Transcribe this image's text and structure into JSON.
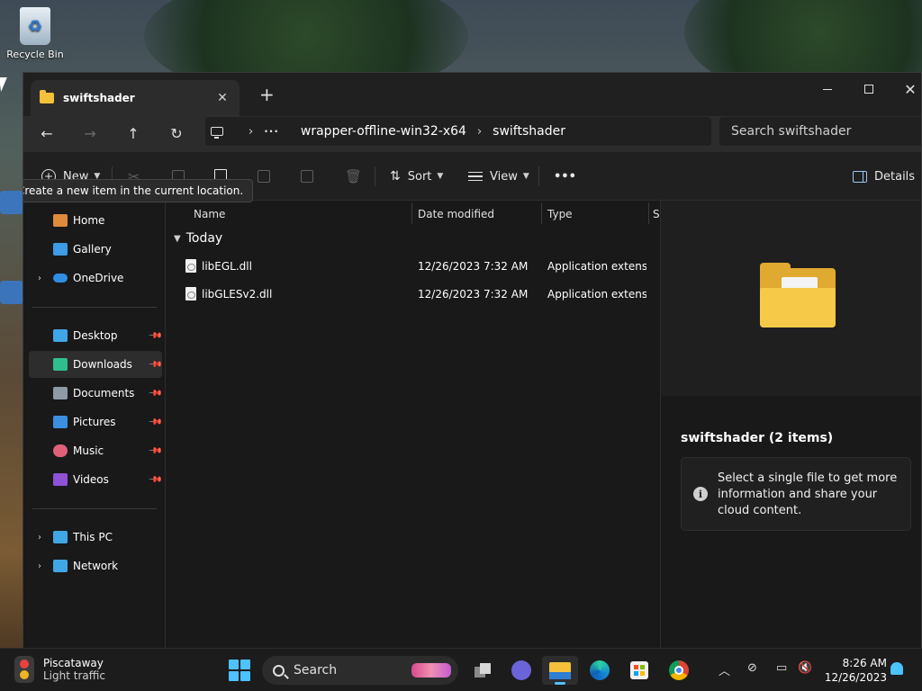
{
  "desktop": {
    "recycle_bin_label": "Recycle Bin"
  },
  "window": {
    "tab_title": "swiftshader",
    "new_tab": "+",
    "tooltip": "Create a new item in the current location.",
    "breadcrumbs": [
      "wrapper-offline-win32-x64",
      "swiftshader"
    ],
    "search_placeholder": "Search swiftshader"
  },
  "commands": {
    "new": "New",
    "sort": "Sort",
    "view": "View",
    "more": "•••",
    "details": "Details"
  },
  "sidebar": {
    "items": [
      {
        "label": "Home",
        "icon": "home-icon",
        "color": "#e08a3c"
      },
      {
        "label": "Gallery",
        "icon": "gallery-icon",
        "color": "#3d9be8"
      },
      {
        "label": "OneDrive",
        "icon": "onedrive-icon",
        "color": "#2f8fe3"
      },
      {
        "label": "Desktop",
        "icon": "desktop-icon",
        "color": "#3fa7e6"
      },
      {
        "label": "Downloads",
        "icon": "downloads-icon",
        "color": "#2fbf8f"
      },
      {
        "label": "Documents",
        "icon": "documents-icon",
        "color": "#8f9aa6"
      },
      {
        "label": "Pictures",
        "icon": "pictures-icon",
        "color": "#3c8fe0"
      },
      {
        "label": "Music",
        "icon": "music-icon",
        "color": "#e0607a"
      },
      {
        "label": "Videos",
        "icon": "videos-icon",
        "color": "#8e52d6"
      },
      {
        "label": "This PC",
        "icon": "this-pc-icon",
        "color": "#3fa7e6"
      },
      {
        "label": "Network",
        "icon": "network-icon",
        "color": "#3fa7e6"
      }
    ],
    "pin_glyph": "📌"
  },
  "filelist": {
    "columns": [
      "Name",
      "Date modified",
      "Type",
      "S"
    ],
    "group": "Today",
    "files": [
      {
        "name": "libEGL.dll",
        "date": "12/26/2023 7:32 AM",
        "type": "Application extens..."
      },
      {
        "name": "libGLESv2.dll",
        "date": "12/26/2023 7:32 AM",
        "type": "Application extens..."
      }
    ]
  },
  "details_pane": {
    "title": "swiftshader (2 items)",
    "info": "Select a single file to get more information and share your cloud content."
  },
  "taskbar": {
    "weather_city": "Piscataway",
    "weather_status": "Light traffic",
    "search_label": "Search",
    "time": "8:26 AM",
    "date": "12/26/2023"
  }
}
